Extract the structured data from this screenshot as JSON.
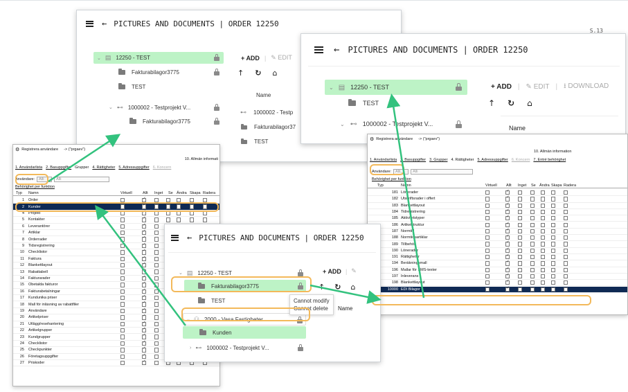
{
  "page_label": "S.13",
  "app": {
    "title": "PICTURES AND DOCUMENTS | ORDER 12250"
  },
  "tree_top": {
    "root": "12250 - TEST",
    "folder1": "Fakturabilagor3775",
    "folder2": "TEST",
    "project": "1000002 - Testprojekt V...",
    "project_folder": "Fakturabilagor3775"
  },
  "toolbar": {
    "add": "ADD",
    "edit": "EDIT",
    "download": "DOWNLOAD"
  },
  "files": {
    "column_name": "Name",
    "rows": [
      "1000002 - Testp",
      "Fakturabilagor37",
      "TEST"
    ]
  },
  "tree_right": {
    "root": "12250 - TEST",
    "folder": "TEST",
    "project": "1000002 - Testprojekt V..."
  },
  "tree_bottom": {
    "root": "12250 - TEST",
    "folder1": "Fakturabilagor3775",
    "folder2": "TEST",
    "group": "2000 - Vasa Fastigheter",
    "group_folder": "Kunden",
    "project": "1000002 - Testprojekt V..."
  },
  "tooltip": [
    "Cannot modify",
    "Cannot delete"
  ],
  "left_table": {
    "title": "Registrera användare",
    "path": "-> (\"prgaev\")",
    "info": "10. Allmän informati",
    "tabs": [
      "1. Användarlista",
      "2. Basuppgifter",
      "Grupper",
      "4. Rättigheter",
      "5. Adressuppgifter",
      "6. Koncern"
    ],
    "user_label": "Användare:",
    "user_value": "Alli",
    "user_value2": "Alli",
    "section": "Behörighet per funktion",
    "columns": [
      "Typ",
      "Namn",
      "Virtuell",
      "Allt",
      "Inget",
      "Se",
      "Ändra",
      "Skapa",
      "Radera"
    ],
    "rows": [
      {
        "n": "1",
        "name": "Order"
      },
      {
        "n": "2",
        "name": "Kunder"
      },
      {
        "n": "4",
        "name": "Projekt"
      },
      {
        "n": "5",
        "name": "Kontakter"
      },
      {
        "n": "6",
        "name": "Leverantörer"
      },
      {
        "n": "7",
        "name": "Artiklar"
      },
      {
        "n": "8",
        "name": "Orderrader"
      },
      {
        "n": "9",
        "name": "Tidsregistrering"
      },
      {
        "n": "10",
        "name": "Checklistor"
      },
      {
        "n": "11",
        "name": "Faktura"
      },
      {
        "n": "12",
        "name": "Blankettlayout"
      },
      {
        "n": "13",
        "name": "Rabattabell"
      },
      {
        "n": "14",
        "name": "Fakturarader"
      },
      {
        "n": "15",
        "name": "Obetalda fakturor"
      },
      {
        "n": "16",
        "name": "Fakturabetalningar"
      },
      {
        "n": "17",
        "name": "Kundunika priser"
      },
      {
        "n": "18",
        "name": "Mall för inläsning av rabattfiler"
      },
      {
        "n": "19",
        "name": "Användare"
      },
      {
        "n": "20",
        "name": "Artikelpriser"
      },
      {
        "n": "21",
        "name": "Utlägg/resehantering"
      },
      {
        "n": "22",
        "name": "Artikelgrupper"
      },
      {
        "n": "23",
        "name": "Kundgrupper"
      },
      {
        "n": "24",
        "name": "Checklistor"
      },
      {
        "n": "25",
        "name": "Checkpunkter"
      },
      {
        "n": "26",
        "name": "Företagsuppgifter"
      },
      {
        "n": "27",
        "name": "Priskoder"
      }
    ]
  },
  "right_table": {
    "title": "Registrera användare",
    "path": "-> (\"prgaev\")",
    "info": "10. Allmän information",
    "tabs": [
      "1. Användarlista",
      "2. Basuppgifter",
      "3. Grupper",
      "4. Rättigheter",
      "5. Adressuppgifter",
      "6. Koncern",
      "7. Entré behörighet"
    ],
    "user_label": "Användare:",
    "user_value": "Alli_",
    "user_value2": "Alli",
    "section": "Behörighet per funktion",
    "columns": [
      "Typ",
      "Namn",
      "Virtuell",
      "Allt",
      "Inget",
      "Se",
      "Ändra",
      "Skapa",
      "Radera"
    ],
    "rows": [
      {
        "n": "181",
        "name": "Lönerader"
      },
      {
        "n": "182",
        "name": "Utskriftsrader i offert"
      },
      {
        "n": "183",
        "name": "Blankettlayout"
      },
      {
        "n": "184",
        "name": "Tidregistrering"
      },
      {
        "n": "185",
        "name": "Aktivitetstyper"
      },
      {
        "n": "186",
        "name": "Artikelstruktur"
      },
      {
        "n": "187",
        "name": "Normtid"
      },
      {
        "n": "188",
        "name": "Normtidsartiklar"
      },
      {
        "n": "189",
        "name": "Tillbehör"
      },
      {
        "n": "190",
        "name": "Lönerader"
      },
      {
        "n": "191",
        "name": "Rättigheter"
      },
      {
        "n": "194",
        "name": "Beräkningsmall"
      },
      {
        "n": "196",
        "name": "Mallar för SMS-texter"
      },
      {
        "n": "197",
        "name": "Inleverans"
      },
      {
        "n": "198",
        "name": "Blankettlayout"
      },
      {
        "n": "10000",
        "name": "EDI Bilagor"
      }
    ]
  },
  "colors": {
    "selection": "#bdf3c6",
    "callout": "#f3b95a",
    "arrow": "#33c27e",
    "row_select": "#0f2a54"
  }
}
